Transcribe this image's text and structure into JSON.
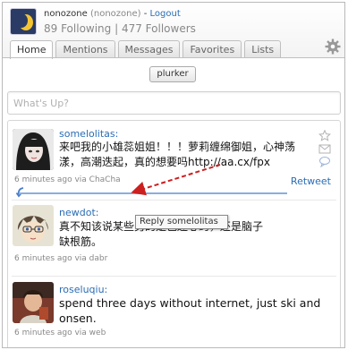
{
  "header": {
    "username": "nonozone",
    "handle": "(nonozone)",
    "separator": " - ",
    "logout": "Logout",
    "stats": "89 Following | 477 Followers"
  },
  "tabs": [
    "Home",
    "Mentions",
    "Messages",
    "Favorites",
    "Lists"
  ],
  "plurker_button": "plurker",
  "compose": {
    "placeholder": "What's Up?"
  },
  "timeline": [
    {
      "name": "somelolitas:",
      "text": "来吧我的小雄蕊姐姐！！！萝莉缠绵御姐，心神荡漾，高潮迭起，真的想要吗http://aa.cx/fpx",
      "meta": "6 minutes ago via ChaCha",
      "action": "Retweet"
    },
    {
      "name": "newdot:",
      "text": "真不知该说某些男的是色迷心窍，还是脑子缺根筋。",
      "meta": "6 minutes ago via dabr"
    },
    {
      "name": "roseluqiu:",
      "text": "spend three days without internet, just ski and onsen.",
      "meta": "6 minutes ago via web"
    }
  ],
  "tooltip": "Reply somelolitas",
  "colors": {
    "link": "#2a6db5",
    "annotation_arrow": "#cc1f1f",
    "reply_bar": "#8aaee0"
  },
  "icons": [
    "star-icon",
    "mail-icon",
    "reply-bubble-icon",
    "gear-icon",
    "reply-arrow-icon"
  ]
}
